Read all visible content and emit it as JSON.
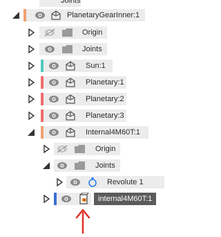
{
  "colors": {
    "orange_stripe": "#f0a070",
    "teal_stripe": "#52c8c0",
    "red_stripe": "#f26b6b",
    "blue_stripe": "#3a6fd8",
    "selected_bg": "#5b5b5b",
    "row_bg": "#ececec",
    "annotation_arrow": "#e0302a"
  },
  "browser": {
    "partial_top_label": "Joints",
    "root": {
      "label": "PlanetaryGearInner:1"
    },
    "origin_label": "Origin",
    "joints_label": "Joints",
    "sun_label": "Sun:1",
    "planetary1_label": "Planetary:1",
    "planetary2_label": "Planetary:2",
    "planetary3_label": "Planetary:3",
    "internal_label": "Internal4M60T:1",
    "sub_origin_label": "Origin",
    "sub_joints_label": "Joints",
    "revolute_label": "Revolute 1",
    "selected_label": "internal4M60T:1"
  },
  "icons": {
    "expand": "triangle-right-outline-icon",
    "collapse": "triangle-down-filled-icon",
    "visible": "eye-icon",
    "hidden": "eye-crossed-icon",
    "folder": "folder-icon",
    "component": "component-icon",
    "joint": "revolute-joint-icon",
    "body": "body-icon",
    "annotation": "red-arrow-annotation"
  }
}
